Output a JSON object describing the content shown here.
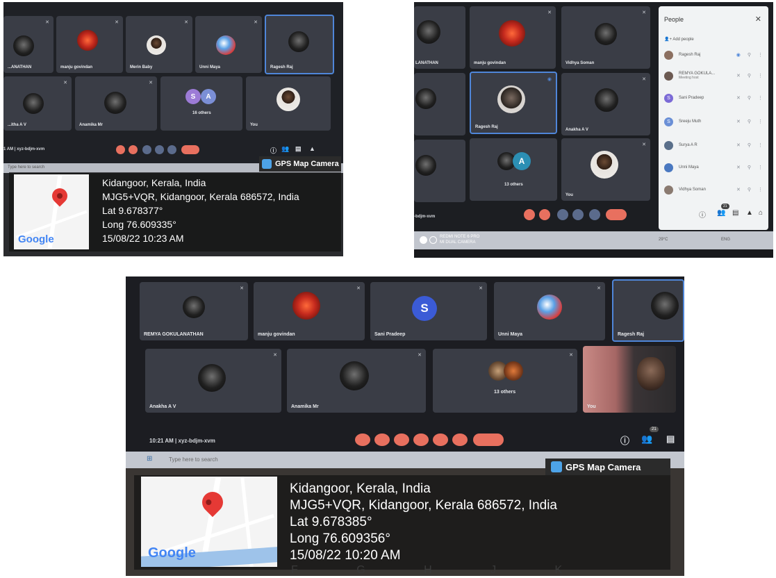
{
  "photo1": {
    "tiles_top": [
      {
        "name": "...ANATHAN"
      },
      {
        "name": "manju govindan"
      },
      {
        "name": "Merin Baby"
      },
      {
        "name": "Unni Maya"
      },
      {
        "name": "Ragesh Raj"
      }
    ],
    "tiles_bottom": [
      {
        "name": "...itha A V"
      },
      {
        "name": "Anamika Mr"
      },
      {
        "name": "16 others",
        "letters": [
          "S",
          "A"
        ]
      },
      {
        "name": "You"
      }
    ],
    "meeting_code": "xyz-bdjm-xvm",
    "time_prefix": "1 AM",
    "search_placeholder": "Type here to search",
    "gps_badge": "GPS Map Camera",
    "location_line1": "Kidangoor, Kerala, India",
    "location_line2": "MJG5+VQR, Kidangoor, Kerala 686572, India",
    "lat": "Lat 9.678377°",
    "long": "Long 76.609335°",
    "datetime": "15/08/22 10:23 AM",
    "map_logo": "Google"
  },
  "photo2": {
    "tiles": [
      {
        "name": "LANATHAN"
      },
      {
        "name": "manju govindan"
      },
      {
        "name": "Vidhya Soman"
      },
      {
        "name": "Ragesh Raj"
      },
      {
        "name": "Anakha A V"
      },
      {
        "name": "13 others",
        "letter": "A"
      },
      {
        "name": "You"
      }
    ],
    "meeting_code": "-bdjm-xvm",
    "people_panel": {
      "title": "People",
      "add": "Add people",
      "rows": [
        {
          "name": "Ragesh Raj"
        },
        {
          "name": "REMYA GOKULA...",
          "sub": "Meeting host"
        },
        {
          "name": "Sani Pradeep",
          "initial": "S"
        },
        {
          "name": "Sreeju Muth",
          "initial": "S"
        },
        {
          "name": "Surya A R"
        },
        {
          "name": "Unni Maya"
        },
        {
          "name": "Vidhya Soman"
        }
      ],
      "badge_count": "21"
    },
    "camera_watermark_line1": "REDMI NOTE 6 PRO",
    "camera_watermark_line2": "MI DUAL CAMERA",
    "tray_temp": "29°C",
    "tray_lang": "ENG"
  },
  "photo3": {
    "tiles_top": [
      {
        "name": "REMYA GOKULANATHAN"
      },
      {
        "name": "manju govindan"
      },
      {
        "name": "Sani Pradeep",
        "letter": "S"
      },
      {
        "name": "Unni Maya"
      },
      {
        "name": "Ragesh Raj"
      }
    ],
    "tiles_bottom": [
      {
        "name": "Anakha A V"
      },
      {
        "name": "Anamika Mr"
      },
      {
        "name": "13 others"
      },
      {
        "name": "You"
      }
    ],
    "time_code": "10:21 AM  |  xyz-bdjm-xvm",
    "badge_count": "21",
    "search_placeholder": "Type here to search",
    "gps_badge": "GPS Map Camera",
    "location_line1": "Kidangoor, Kerala, India",
    "location_line2": "MJG5+VQR, Kidangoor, Kerala 686572, India",
    "lat": "Lat 9.678385°",
    "long": "Long 76.609356°",
    "datetime": "15/08/22 10:20 AM",
    "map_logo": "Google",
    "keyboard_letters": "F G H J K"
  },
  "colors": {
    "tile": "#3a3d46",
    "active_border": "#4f86d9",
    "end_call": "#e8705f",
    "control": "#5b6b8c",
    "pin": "#e53935"
  },
  "icons": [
    "mic-off-icon",
    "camera-icon",
    "hangup-icon",
    "people-icon",
    "chat-icon",
    "info-icon",
    "map-pin-icon",
    "close-icon"
  ]
}
